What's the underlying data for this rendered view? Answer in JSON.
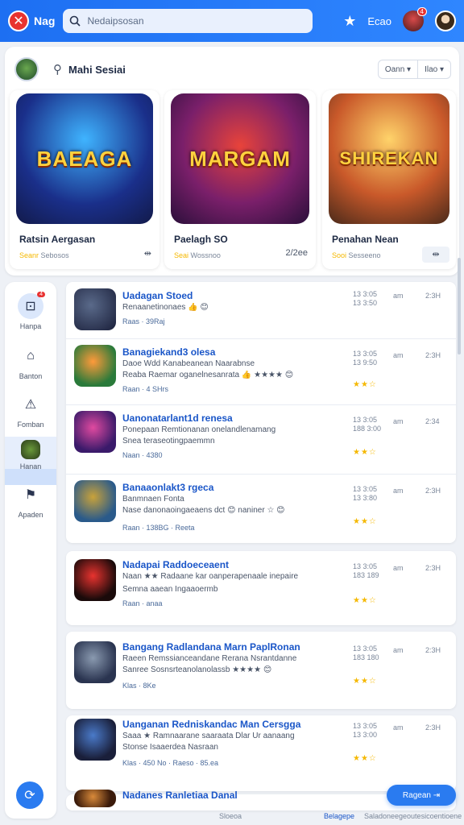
{
  "topbar": {
    "logo_text": "Nag",
    "search_placeholder": "Nedaipsosan",
    "star_label": "★",
    "text_btn": "Ecao",
    "notif_count": "4"
  },
  "featured": {
    "title": "Mahi Sesiai",
    "dropdown_left": "Oann ▾",
    "dropdown_right": "Ilao ▾",
    "cards": [
      {
        "art_title": "BAEAGA",
        "name": "Ratsin Aergasan",
        "meta": "Seanr",
        "meta2": "Sebosos",
        "act": "⇹"
      },
      {
        "art_title": "MARGAM",
        "name": "Paelagh SO",
        "meta": "Seai",
        "meta2": "Wossnoo",
        "act": "2/2ee"
      },
      {
        "art_title": "SHIREKAN",
        "name": "Penahan Nean",
        "meta": "Sooi",
        "meta2": "Sesseeno",
        "act": "⇹"
      }
    ]
  },
  "nav": {
    "items": [
      {
        "label": "Hanpa",
        "icon": "⊡",
        "badge": "4"
      },
      {
        "label": "Banton",
        "icon": "⌂"
      },
      {
        "label": "Fomban",
        "icon": "⚠"
      },
      {
        "label": "Hanan",
        "icon": "◆"
      },
      {
        "label": "Apaden",
        "icon": "⚑"
      }
    ],
    "fab_icon": "⟳"
  },
  "list": [
    {
      "title": "Uadagan Stoed",
      "line1": "Renaanetinonaes 👍 😊",
      "line2": "",
      "foot": "Raas · 39Raj",
      "date": "13 3:05\n13 3:50",
      "c2": "am",
      "c3": "2:3H",
      "stars": ""
    },
    {
      "title": "Banagiekand3 olesa",
      "line1": "Daoe Wdd Kanabeanean Naarabnse",
      "line2": "Reaba Raemar oganelnesanrata 👍 ★★★★ 😊",
      "foot": "Raan · 4 SHrs",
      "date": "13 3:05\n13 9:50",
      "c2": "am",
      "c3": "2:3H",
      "stars": "★★☆"
    },
    {
      "title": "Uanonatarlant1d renesa",
      "line1": "Ponepaan Remtionanan onelandlenamang",
      "line2": "Snea teraseotingpaemmn",
      "foot": "Naan · 4380",
      "date": "13 3:05\n188 3:00",
      "c2": "am",
      "c3": "2:34",
      "stars": "★★☆"
    },
    {
      "title": "Banaaonlakt3 rgeca",
      "line1": "Banmnaen Fonta",
      "line2": "Nase danonaoingaeaens dct 😊 naniner ☆ 😊",
      "foot": "Raan · 138BG · Reeta",
      "date": "13 3:05\n13 3:80",
      "c2": "am",
      "c3": "2:3H",
      "stars": "★★☆"
    },
    {
      "title": "Nadapai Raddoeceaent",
      "line1": "Naan ★★ Radaane kar oanperapenaale inepaire",
      "line2": "Semna aaean Ingaaoermb",
      "foot": "Raan · anaa",
      "date": "13 3:05\n183 189",
      "c2": "am",
      "c3": "2:3H",
      "stars": "★★☆"
    },
    {
      "title": "Bangang Radlandana Marn PaplRonan",
      "line1": "Raeen Remssianceandane Rerana Nsrantdanne",
      "line2": "Sanree Sosnsrteanolanolassb ★★★★ 😊",
      "foot": "Klas · 8Ke",
      "date": "13 3:05\n183 180",
      "c2": "am",
      "c3": "2:3H",
      "stars": "★★☆"
    },
    {
      "title": "Uanganan Redniskandac Man Cersgga",
      "line1": "Saaa ★ Ramnaarane saaraata Dlar Ur aanaang",
      "line2": "Stonse Isaaerdea Nasraan",
      "foot": "Klas · 450 No · Raeso · 85.ea",
      "date": "13 3:05\n13 3:00",
      "c2": "am",
      "c3": "2:3H",
      "stars": "★★☆"
    },
    {
      "title": "Nadanes Ranletiaa Danal",
      "line1": "",
      "line2": "",
      "foot": "",
      "date": "",
      "c2": "",
      "c3": "",
      "stars": ""
    }
  ],
  "footer": {
    "f1": "Sloeoa",
    "f2": "Belagepe",
    "f3": "Saladoneegeoutesicoentioene",
    "pill_label": "Ragean ⇥"
  }
}
